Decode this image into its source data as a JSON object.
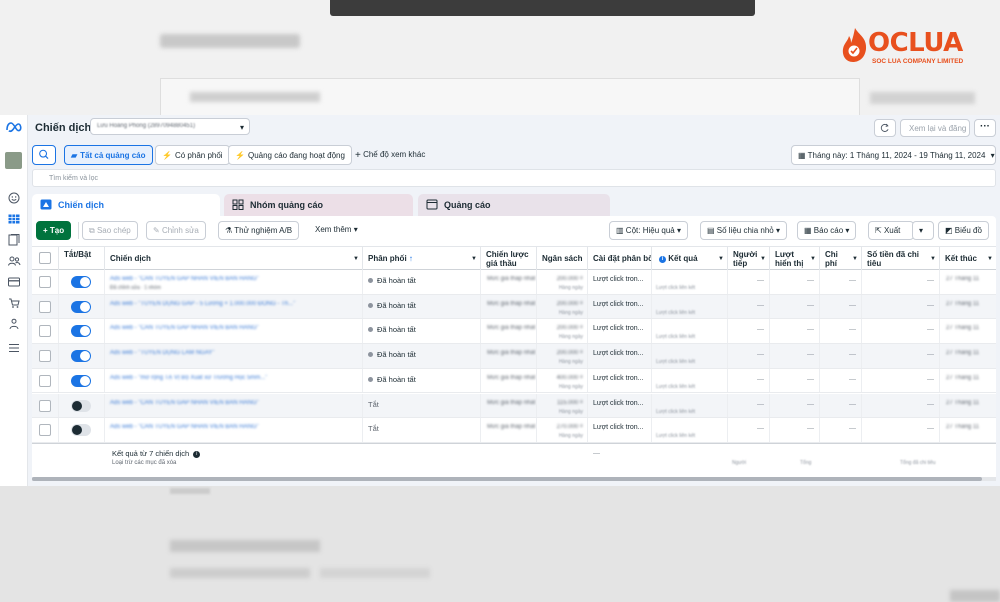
{
  "watermark": {
    "brand": "OCLUA",
    "tagline": "SOC LUA COMPANY LIMITED",
    "accent": "#e8501e"
  },
  "header": {
    "title": "Chiến dịch",
    "account_name": "Lưu Hoàng Phong (2897094880451)",
    "review_button": "Xem lại và đăng",
    "more_button": "···"
  },
  "filters": {
    "all_ads": "Tất cả quảng cáo",
    "has_delivery": "Có phân phối",
    "active_ads": "Quảng cáo đang hoạt động",
    "other_views": "Chế độ xem khác",
    "date_range": "Tháng này: 1 Tháng 11, 2024 - 19 Tháng 11, 2024",
    "search_placeholder": "Tìm kiếm và lọc"
  },
  "tabs": [
    {
      "label": "Chiến dịch",
      "active": true
    },
    {
      "label": "Nhóm quảng cáo",
      "active": false
    },
    {
      "label": "Quảng cáo",
      "active": false
    }
  ],
  "toolbar": {
    "create": "Tạo",
    "duplicate": "Sao chép",
    "edit": "Chỉnh sửa",
    "ab_test": "Thử nghiệm A/B",
    "more": "Xem thêm",
    "columns": "Cột: Hiệu quả",
    "breakdown": "Số liệu chia nhỏ",
    "reports": "Báo cáo",
    "export": "Xuất",
    "charts": "Biểu đồ"
  },
  "table": {
    "columns": {
      "onoff": "Tắt/Bật",
      "campaign": "Chiến dịch",
      "delivery": "Phân phối",
      "delivery_sort": "↑",
      "bid_strategy_1": "Chiến lược",
      "bid_strategy_2": "giá thầu",
      "budget": "Ngân sách",
      "attribution": "Cài đặt phân bổ",
      "results": "Kết quả",
      "reach_1": "Người",
      "reach_2": "tiếp",
      "impressions_1": "Lượt",
      "impressions_2": "hiển thị",
      "cost_1": "Chi",
      "cost_2": "phí",
      "amount_spent_1": "Số tiền đã chi",
      "amount_spent_2": "tiêu",
      "ends": "Kết thúc"
    },
    "rows": [
      {
        "on": true,
        "name": "Ads web - \"CẦN TUYỂN GẤP NHÂN VIÊN BÁN HÀNG\"",
        "sub": "Đã chỉnh sửa · 1 nhóm",
        "delivery": "Đã hoàn tất",
        "bid": "Mức giá thấp nhất",
        "budget": "200.000 ₫",
        "budget_sub": "Hàng ngày",
        "attribution": "Lượt click tron...",
        "results_sub": "Lượt click liên kết",
        "end": "27 Tháng 11"
      },
      {
        "on": true,
        "name": "Ads web - \"TUYỂN DỤNG GẤP - 5 Lương + 1.000.000 ĐỒNG - Th...\"",
        "sub": "",
        "delivery": "Đã hoàn tất",
        "bid": "Mức giá thấp nhất",
        "budget": "200.000 ₫",
        "budget_sub": "Hàng ngày",
        "attribution": "Lượt click tron...",
        "results_sub": "Lượt click liên kết",
        "end": "27 Tháng 11"
      },
      {
        "on": true,
        "name": "Ads web - \"CẦN TUYỂN GẤP NHÂN VIÊN BÁN HÀNG\"",
        "sub": "",
        "delivery": "Đã hoàn tất",
        "bid": "Mức giá thấp nhất",
        "budget": "200.000 ₫",
        "budget_sub": "Hàng ngày",
        "attribution": "Lượt click tron...",
        "results_sub": "Lượt click liên kết",
        "end": "27 Tháng 11"
      },
      {
        "on": true,
        "name": "Ads web - \"TUYỂN DỤNG LÀM NGAY\"",
        "sub": "",
        "delivery": "Đã hoàn tất",
        "bid": "Mức giá thấp nhất",
        "budget": "200.000 ₫",
        "budget_sub": "Hàng ngày",
        "attribution": "Lượt click tron...",
        "results_sub": "Lượt click liên kết",
        "end": "27 Tháng 11"
      },
      {
        "on": true,
        "name": "Ads web - \"mở rộng TẠ VỊ Bộ Xuất xứ Trường Học 5mm...\"",
        "sub": "",
        "delivery": "Đã hoàn tất",
        "bid": "Mức giá thấp nhất",
        "budget": "400.000 ₫",
        "budget_sub": "Hàng ngày",
        "attribution": "Lượt click tron...",
        "results_sub": "Lượt click liên kết",
        "end": "27 Tháng 11"
      },
      {
        "on": false,
        "name": "Ads web - \"CẦN TUYỂN GẤP NHÂN VIÊN BÁN HÀNG\"",
        "sub": "",
        "delivery": "Tắt",
        "bid": "Mức giá thấp nhất",
        "budget": "115.000 ₫",
        "budget_sub": "Hàng ngày",
        "attribution": "Lượt click tron...",
        "results_sub": "Lượt click liên kết",
        "end": "27 Tháng 11"
      },
      {
        "on": false,
        "name": "Ads web - \"CẦN TUYỂN GẤP NHÂN VIÊN BÁN HÀNG\"",
        "sub": "",
        "delivery": "Tắt",
        "bid": "Mức giá thấp nhất",
        "budget": "270.000 ₫",
        "budget_sub": "Hàng ngày",
        "attribution": "Lượt click tron...",
        "results_sub": "Lượt click liên kết",
        "end": "27 Tháng 11"
      }
    ],
    "footer": {
      "summary": "Kết quả từ 7 chiến dịch",
      "note": "Loại trừ các mục đã xóa",
      "attribution": "—",
      "reach_label": "Người",
      "impr_label": "Tổng",
      "spend_label": "Tổng đã chi tiêu"
    }
  }
}
